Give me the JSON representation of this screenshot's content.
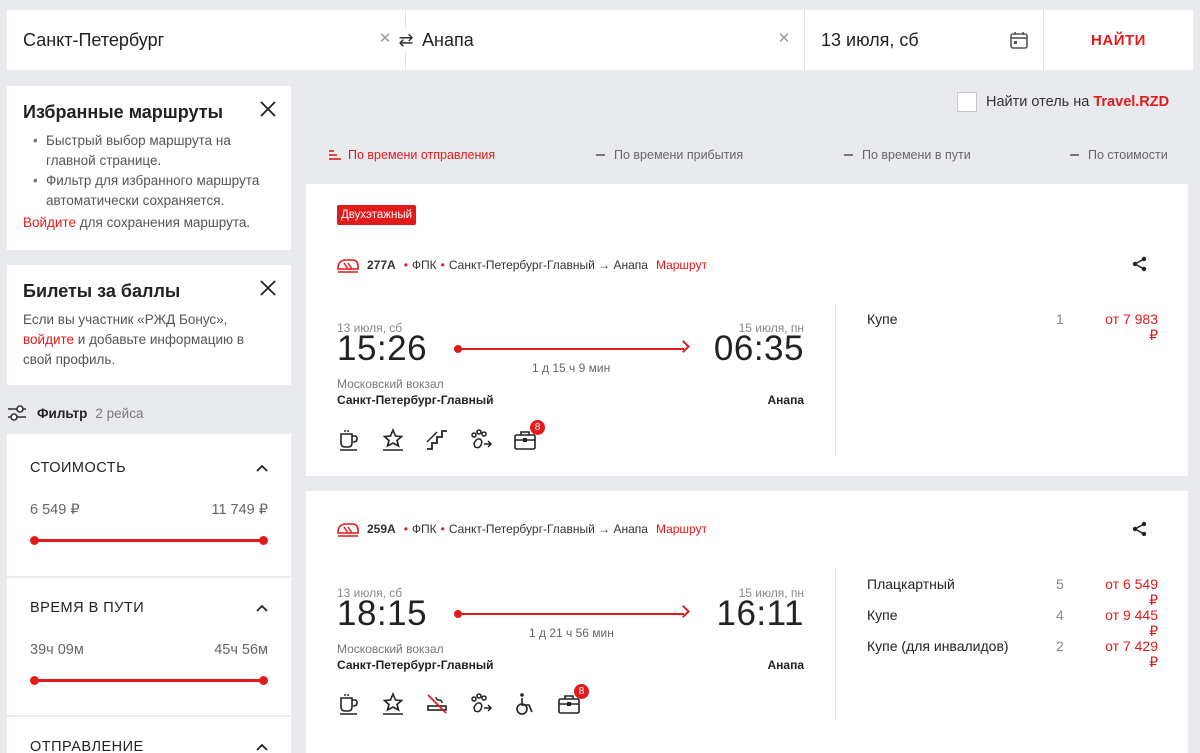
{
  "search": {
    "from": "Санкт-Петербург",
    "to": "Анапа",
    "date": "13 июля, сб",
    "find_label": "НАЙТИ"
  },
  "favorites": {
    "title": "Избранные маршруты",
    "bullets": [
      "Быстрый выбор маршрута на главной странице.",
      "Фильтр для избранного маршрута автоматически сохраняется."
    ],
    "login_link": "Войдите",
    "login_note": " для сохранения маршрута."
  },
  "points": {
    "title": "Билеты за баллы",
    "text_before": "Если вы участник «РЖД Бонус»,",
    "link": "войдите",
    "text_after": " и добавьте информацию в свой профиль."
  },
  "filter": {
    "label": "Фильтр",
    "count": "2 рейса"
  },
  "filters": [
    {
      "title": "СТОИМОСТЬ",
      "min": "6 549 ₽",
      "max": "11 749 ₽"
    },
    {
      "title": "ВРЕМЯ В ПУТИ",
      "min": "39ч 09м",
      "max": "45ч 56м"
    },
    {
      "title": "ОТПРАВЛЕНИЕ"
    }
  ],
  "hotel": {
    "text": "Найти отель на ",
    "brand": "Travel.RZD"
  },
  "sort": [
    {
      "label": "По времени отправления",
      "active": true
    },
    {
      "label": "По времени прибытия",
      "active": false
    },
    {
      "label": "По времени в пути",
      "active": false
    },
    {
      "label": "По стоимости",
      "active": false
    }
  ],
  "trains": [
    {
      "badge": "Двухэтажный",
      "number": "277А",
      "carrier": "ФПК",
      "route": "Санкт-Петербург-Главный → Анапа",
      "route_link": "Маршрут",
      "dep_date": "13 июля, сб",
      "dep_time": "15:26",
      "arr_date": "15 июля, пн",
      "arr_time": "06:35",
      "duration": "1 д 15 ч 9 мин",
      "dep_station_note": "Московский вокзал",
      "dep_station": "Санкт-Петербург-Главный",
      "arr_station": "Анапа",
      "icons": [
        "coffee-icon",
        "star-service-icon",
        "stairs-icon",
        "pet-icon",
        "luggage-icon"
      ],
      "luggage_count": "8",
      "classes": [
        {
          "name": "Купе",
          "seats": "1",
          "price": "от 7 983 ₽"
        }
      ]
    },
    {
      "number": "259А",
      "carrier": "ФПК",
      "route": "Санкт-Петербург-Главный → Анапа",
      "route_link": "Маршрут",
      "dep_date": "13 июля, сб",
      "dep_time": "18:15",
      "arr_date": "15 июля, пн",
      "arr_time": "16:11",
      "duration": "1 д 21 ч 56 мин",
      "dep_station_note": "Московский вокзал",
      "dep_station": "Санкт-Петербург-Главный",
      "arr_station": "Анапа",
      "icons": [
        "coffee-icon",
        "star-service-icon",
        "no-smoking-icon",
        "pet-icon",
        "wheelchair-icon",
        "luggage-icon"
      ],
      "luggage_count": "8",
      "classes": [
        {
          "name": "Плацкартный",
          "seats": "5",
          "price": "от 6 549 ₽"
        },
        {
          "name": "Купе",
          "seats": "4",
          "price": "от 9 445 ₽"
        },
        {
          "name": "Купе (для инвалидов)",
          "seats": "2",
          "price": "от 7 429 ₽"
        }
      ]
    }
  ],
  "colors": {
    "accent": "#e21a1a",
    "background": "#e9eaee"
  }
}
